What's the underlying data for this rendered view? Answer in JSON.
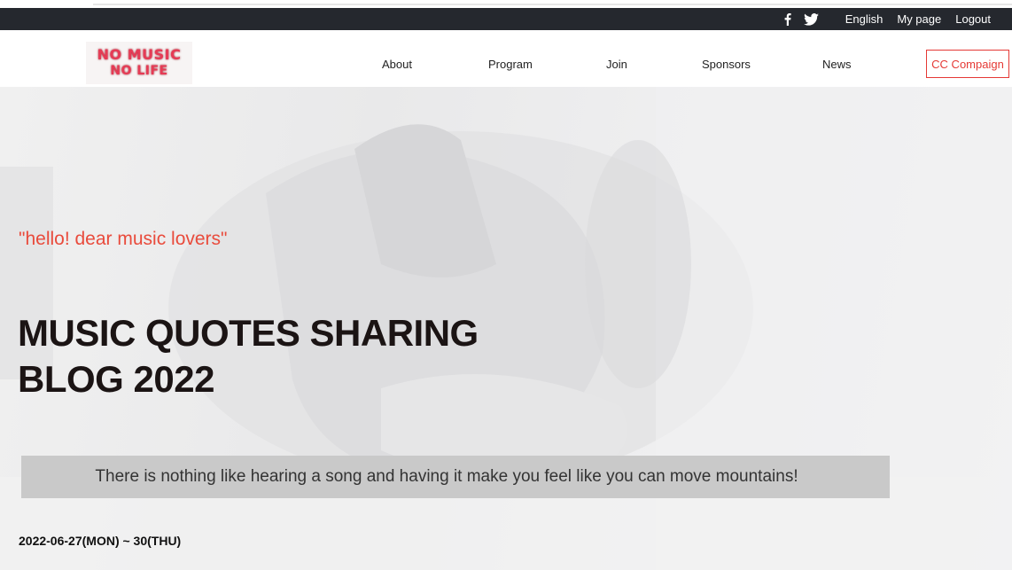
{
  "utility": {
    "social": [
      {
        "icon": "facebook-icon",
        "glyph": "f"
      },
      {
        "icon": "twitter-icon",
        "glyph": "bird"
      }
    ],
    "links": [
      "English",
      "My page",
      "Logout"
    ]
  },
  "header": {
    "logo": {
      "line1": "NO MUSIC",
      "line2": "NO LIFE"
    },
    "nav": [
      "About",
      "Program",
      "Join",
      "Sponsors",
      "News"
    ],
    "cta": "CC Compaign"
  },
  "hero": {
    "greeting": "\"hello! dear music lovers\"",
    "title_line1": "MUSIC QUOTES SHARING",
    "title_line2": "BLOG 2022",
    "quote": "There is nothing like hearing a song and having it make you feel like you can move mountains!",
    "date": "2022-06-27(MON) ~ 30(THU)"
  },
  "colors": {
    "utility_bar": "#25282e",
    "accent": "#e94b3c",
    "cta_border": "#e53935",
    "quote_box": "#c9c9c9"
  }
}
